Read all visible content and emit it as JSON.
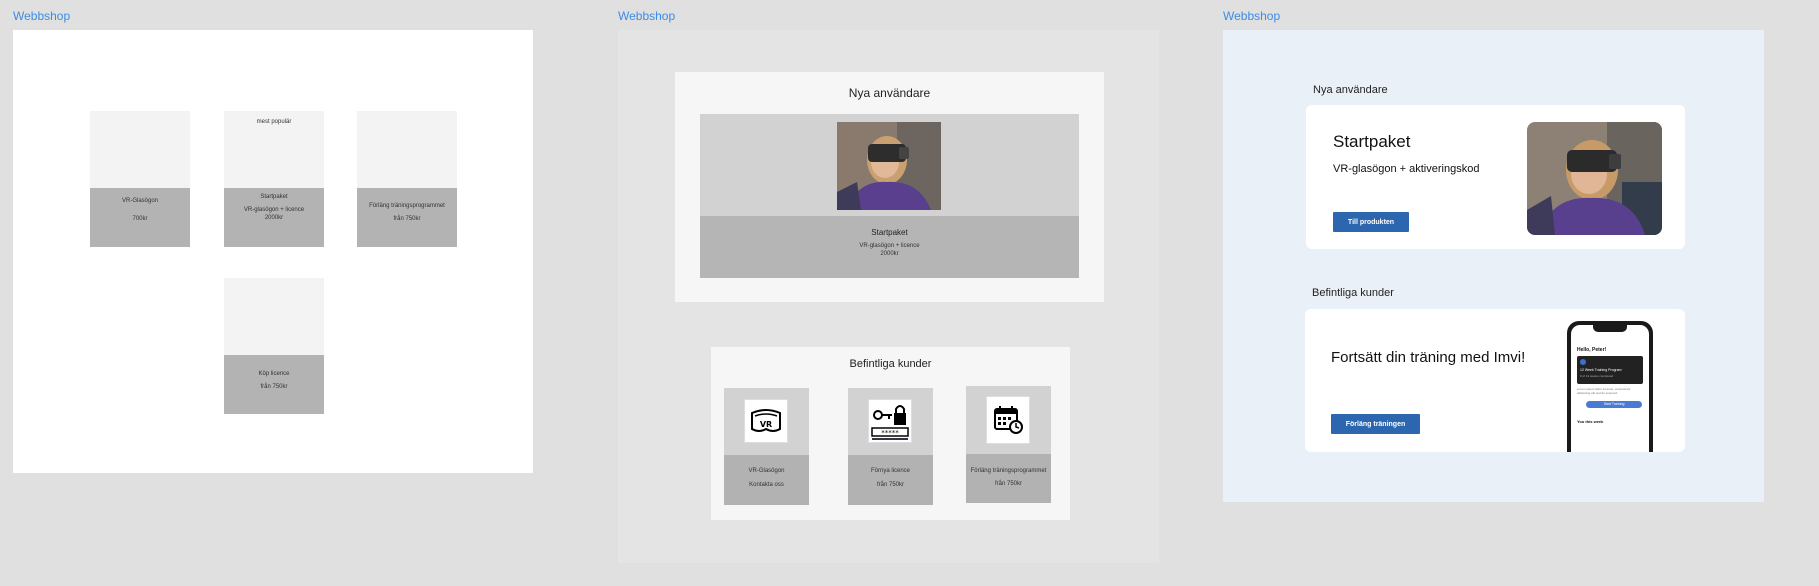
{
  "frames": [
    {
      "label": "Webbshop"
    },
    {
      "label": "Webbshop"
    },
    {
      "label": "Webbshop"
    }
  ],
  "frame1": {
    "cards": [
      {
        "name": "VR-Glasögon",
        "price": "700kr"
      },
      {
        "badge": "mest populär",
        "name": "Startpaket",
        "desc": "VR-glasögon + licence",
        "price": "2000kr"
      },
      {
        "name": "Förläng träningsprogrammet",
        "price": "från 750kr"
      },
      {
        "name": "Köp licence",
        "price": "från 750kr"
      }
    ]
  },
  "frame2": {
    "new_users": {
      "title": "Nya användare",
      "name": "Startpaket",
      "desc": "VR-glasögon + licence",
      "price": "2000kr"
    },
    "existing": {
      "title": "Befintliga kunder",
      "cards": [
        {
          "icon": "vr-headset-icon",
          "title": "VR-Glasögon",
          "sub": "Kontakta oss"
        },
        {
          "icon": "key-lock-icon",
          "title": "Förnya licence",
          "sub": "från 750kr"
        },
        {
          "icon": "calendar-icon",
          "title": "Förläng träningsprogrammet",
          "sub": "från 750kr"
        }
      ]
    }
  },
  "frame3": {
    "new_users_heading": "Nya användare",
    "startpaket": {
      "title": "Startpaket",
      "desc": "VR-glasögon + aktiveringskod",
      "button": "Till produkten"
    },
    "existing_heading": "Befintliga kunder",
    "continue": {
      "title": "Fortsätt din träning med Imvi!",
      "button": "Förläng träningen"
    },
    "phone": {
      "greeting": "Hello, Peter!",
      "program": "12 Week Training Program",
      "progress": "0 of 12 weeks completed",
      "note": "Lorem ipsum dolor sit amet, consectetur adipiscing elit sed do eiusmod.",
      "button": "Start Training",
      "week": "You this week"
    }
  },
  "colors": {
    "accent": "#3b8ce5",
    "button": "#2c66ae",
    "frame3_bg": "#eaf0f7"
  }
}
